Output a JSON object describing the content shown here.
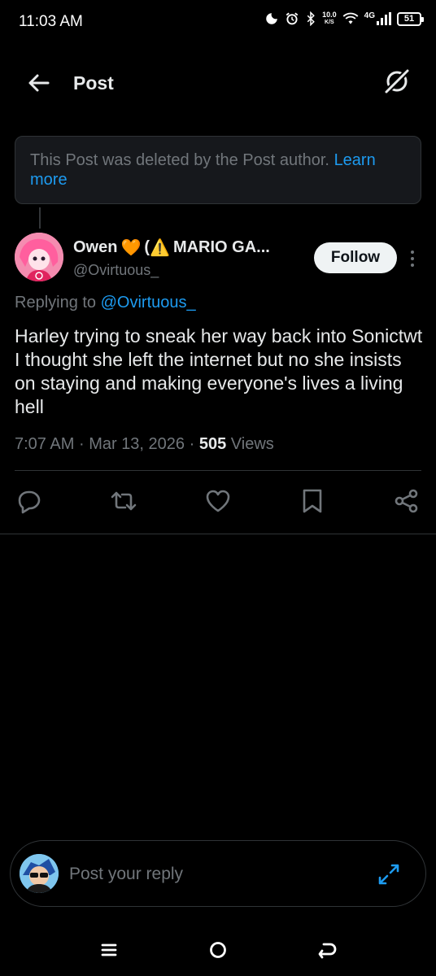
{
  "status_bar": {
    "time": "11:03 AM",
    "net_speed_value": "10.0",
    "net_speed_unit": "K/S",
    "network_type": "4G",
    "battery": "51",
    "icons": [
      "moon-icon",
      "alarm-icon",
      "bluetooth-icon",
      "wifi-icon",
      "signal-icon",
      "battery-icon"
    ]
  },
  "header": {
    "title": "Post",
    "back_icon": "arrow-left-icon",
    "grok_icon": "grok-icon"
  },
  "notice": {
    "text": "This Post was deleted by the Post author.",
    "link": "Learn more"
  },
  "post": {
    "author_name": "Owen",
    "author_name_suffix": "(",
    "author_name_rest": "MARIO GA...",
    "emoji_heart": "🧡",
    "emoji_warning": "⚠️",
    "handle": "@Ovirtuous_",
    "follow_label": "Follow",
    "replying_prefix": "Replying to",
    "replying_to": "@Ovirtuous_",
    "text": "Harley trying to sneak her way back into Sonictwt I thought she left the internet but no she insists on staying and making everyone's lives a living hell",
    "time": "7:07 AM",
    "separator": "·",
    "date": "Mar 13, 2026",
    "views_count": "505",
    "views_label": "Views"
  },
  "actions": [
    "reply-icon",
    "repost-icon",
    "like-icon",
    "bookmark-icon",
    "share-icon"
  ],
  "composer": {
    "placeholder": "Post your reply"
  },
  "colors": {
    "background": "#000000",
    "accent": "#1d9bf0",
    "text_primary": "#e7e9ea",
    "text_secondary": "#71767b",
    "border": "#2f3336"
  }
}
